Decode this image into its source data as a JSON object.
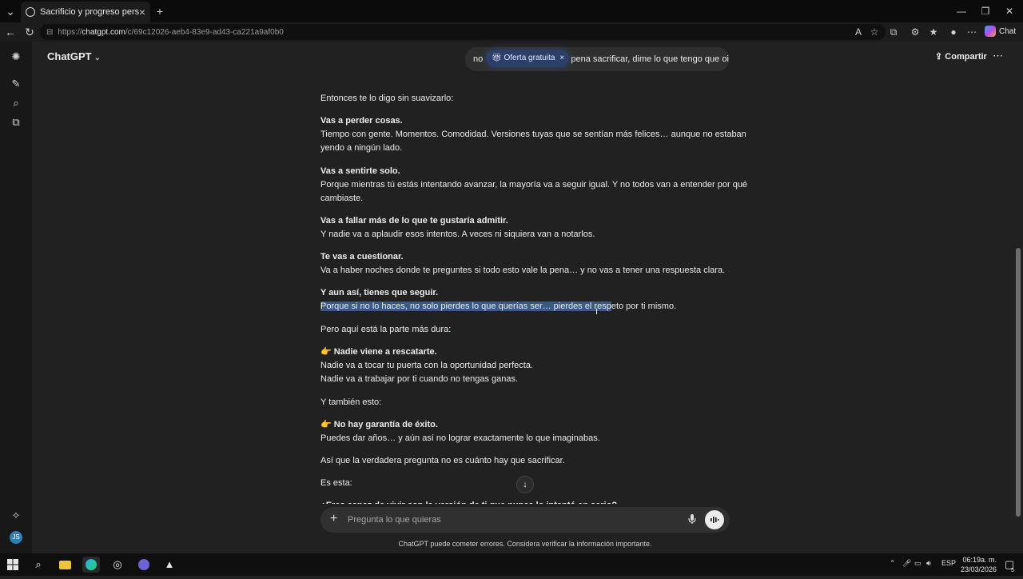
{
  "browser": {
    "tab_title": "Sacrificio y progreso personal",
    "tab_close": "×",
    "new_tab": "+",
    "url_scheme": "https://",
    "url_host": "chatgpt.com",
    "url_path": "/c/69c12026-aeb4-83e9-ad43-ca221a9af0b0",
    "copilot_label": "Chat"
  },
  "header": {
    "model": "ChatGPT",
    "previous_question_prefix": "no",
    "previous_question_suffix": "pena sacrificar, dime lo que tengo que oir",
    "offer_label": "Oferta gratuita",
    "offer_close": "×",
    "share_label": "Compartir"
  },
  "conversation": {
    "lines": [
      {
        "text": "Entonces te lo digo sin suavizarlo:",
        "bold": false
      },
      {
        "text": "Vas a perder cosas.",
        "bold": true
      },
      {
        "text": "Tiempo con gente. Momentos. Comodidad. Versiones tuyas que se sentían más felices… aunque no estaban",
        "bold": false
      },
      {
        "text": "yendo a ningún lado.",
        "bold": false
      },
      {
        "text": "Vas a sentirte solo.",
        "bold": true
      },
      {
        "text": "Porque mientras tú estás intentando avanzar, la mayoría va a seguir igual. Y no todos van a entender por qué",
        "bold": false
      },
      {
        "text": "cambiaste.",
        "bold": false
      },
      {
        "text": "Vas a fallar más de lo que te gustaría admitir.",
        "bold": true
      },
      {
        "text": "Y nadie va a aplaudir esos intentos. A veces ni siquiera van a notarlos.",
        "bold": false
      },
      {
        "text": "Te vas a cuestionar.",
        "bold": true
      },
      {
        "text": "Va a haber noches donde te preguntes si todo esto vale la pena… y no vas a tener una respuesta clara.",
        "bold": false
      },
      {
        "text": "Y aun así, tienes que seguir.",
        "bold": true
      },
      {
        "text_selected": "Porque si no lo haces, no solo pierdes lo que querías ser… pierdes el resp",
        "text_rest": "eto por ti mismo.",
        "bold": false
      },
      {
        "text": "Pero aquí está la parte más dura:",
        "bold": false
      },
      {
        "emoji": "👉",
        "text": "Nadie viene a rescatarte.",
        "bold": true
      },
      {
        "text": "Nadie va a tocar tu puerta con la oportunidad perfecta.",
        "bold": false
      },
      {
        "text": "Nadie va a trabajar por ti cuando no tengas ganas.",
        "bold": false
      },
      {
        "text": "Y también esto:",
        "bold": false
      },
      {
        "emoji": "👉",
        "text": "No hay garantía de éxito.",
        "bold": true
      },
      {
        "text": "Puedes dar años… y aún así no lograr exactamente lo que imaginabas.",
        "bold": false
      },
      {
        "text": "Así que la verdadera pregunta no es cuánto hay que sacrificar.",
        "bold": false
      },
      {
        "text": "Es esta:",
        "bold": false
      },
      {
        "text": "¿Eres capaz de vivir con la versión de ti que nunca lo intentó en serio?",
        "bold": true
      }
    ]
  },
  "composer": {
    "placeholder": "Pregunta lo que quieras",
    "plus": "+"
  },
  "footer": {
    "disclaimer": "ChatGPT puede cometer errores. Considera verificar la información importante."
  },
  "taskbar": {
    "language": "ESP",
    "time": "06:19a. m.",
    "date": "23/03/2026",
    "notifications": "5"
  },
  "icons": {
    "back": "back-arrow-icon",
    "refresh": "refresh-icon",
    "new_chat": "new-chat-icon",
    "search": "search-icon",
    "library": "library-icon",
    "scroll_down": "arrow-down-icon",
    "mic": "microphone-icon",
    "voice": "voice-mode-icon"
  },
  "colors": {
    "background": "#212121",
    "selection": "#3a5a84",
    "offer_pill": "#2c3f68"
  }
}
